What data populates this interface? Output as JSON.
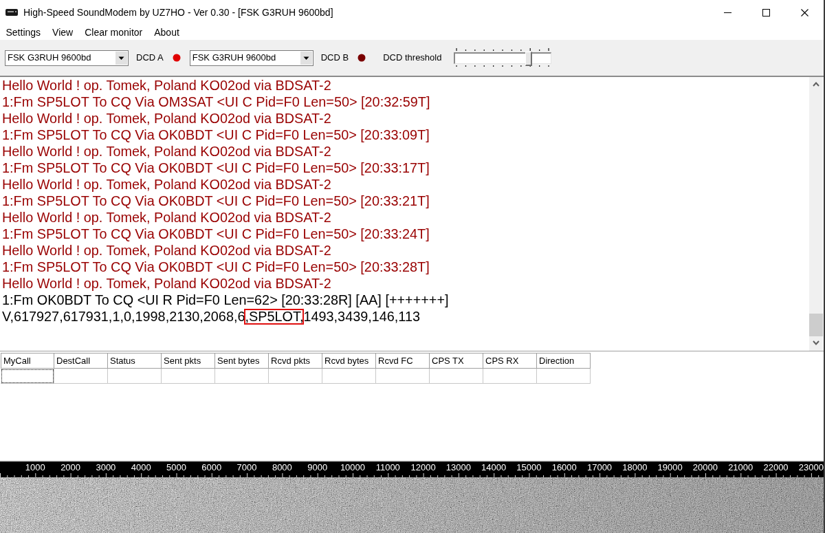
{
  "window": {
    "title": "High-Speed SoundModem by UZ7HO - Ver 0.30 - [FSK G3RUH 9600bd]"
  },
  "menu": [
    "Settings",
    "View",
    "Clear monitor",
    "About"
  ],
  "toolbar": {
    "channels": [
      {
        "mode": "FSK G3RUH 9600bd",
        "label": "DCD A",
        "on": true
      },
      {
        "mode": "FSK G3RUH 9600bd",
        "label": "DCD B",
        "on": false
      }
    ],
    "threshold": {
      "label": "DCD threshold",
      "level": 0.8
    }
  },
  "monitor": {
    "lines": [
      {
        "text": "Hello World ! op. Tomek, Poland KO02od via BDSAT-2",
        "color": "#990000"
      },
      {
        "text": "1:Fm SP5LOT To CQ Via OM3SAT <UI C Pid=F0 Len=50> [20:32:59T]",
        "color": "#990000"
      },
      {
        "text": "Hello World ! op. Tomek, Poland KO02od via BDSAT-2",
        "color": "#990000"
      },
      {
        "text": "1:Fm SP5LOT To CQ Via OK0BDT <UI C Pid=F0 Len=50> [20:33:09T]",
        "color": "#990000"
      },
      {
        "text": "Hello World ! op. Tomek, Poland KO02od via BDSAT-2",
        "color": "#990000"
      },
      {
        "text": "1:Fm SP5LOT To CQ Via OK0BDT <UI C Pid=F0 Len=50> [20:33:17T]",
        "color": "#990000"
      },
      {
        "text": "Hello World ! op. Tomek, Poland KO02od via BDSAT-2",
        "color": "#990000"
      },
      {
        "text": "1:Fm SP5LOT To CQ Via OK0BDT <UI C Pid=F0 Len=50> [20:33:21T]",
        "color": "#990000"
      },
      {
        "text": "Hello World ! op. Tomek, Poland KO02od via BDSAT-2",
        "color": "#990000"
      },
      {
        "text": "1:Fm SP5LOT To CQ Via OK0BDT <UI C Pid=F0 Len=50> [20:33:24T]",
        "color": "#990000"
      },
      {
        "text": "Hello World ! op. Tomek, Poland KO02od via BDSAT-2",
        "color": "#990000"
      },
      {
        "text": "1:Fm SP5LOT To CQ Via OK0BDT <UI C Pid=F0 Len=50> [20:33:28T]",
        "color": "#990000"
      },
      {
        "text": "Hello World ! op. Tomek, Poland KO02od via BDSAT-2",
        "color": "#990000"
      },
      {
        "text": "1:Fm OK0BDT To CQ <UI R Pid=F0 Len=62> [20:33:28R] [AA] [+++++++]",
        "color": "#000000"
      },
      {
        "parts": [
          {
            "text": "V,617927,617931,1,0,1998,2130,2068,6",
            "boxed": false
          },
          {
            "text": ",SP5LOT,",
            "boxed": true
          },
          {
            "text": "1493,3439,146,113",
            "boxed": false
          }
        ],
        "color": "#000000"
      }
    ]
  },
  "table": {
    "columns": [
      "MyCall",
      "DestCall",
      "Status",
      "Sent pkts",
      "Sent bytes",
      "Rcvd pkts",
      "Rcvd bytes",
      "Rcvd FC",
      "CPS TX",
      "CPS RX",
      "Direction"
    ],
    "rows": [
      {
        "cells": [
          {
            "focused": true
          },
          {
            "focused": false
          },
          {
            "focused": false
          },
          {
            "focused": false
          },
          {
            "focused": false
          },
          {
            "focused": false
          },
          {
            "focused": false
          },
          {
            "focused": false
          },
          {
            "focused": false
          },
          {
            "focused": false
          },
          {
            "focused": false
          }
        ]
      }
    ]
  },
  "waterfall": {
    "scale": [
      "1000",
      "2000",
      "3000",
      "4000",
      "5000",
      "6000",
      "7000",
      "8000",
      "9000",
      "10000",
      "11000",
      "12000",
      "13000",
      "14000",
      "15000",
      "16000",
      "17000",
      "18000",
      "19000",
      "20000",
      "21000",
      "22000",
      "23000"
    ]
  }
}
